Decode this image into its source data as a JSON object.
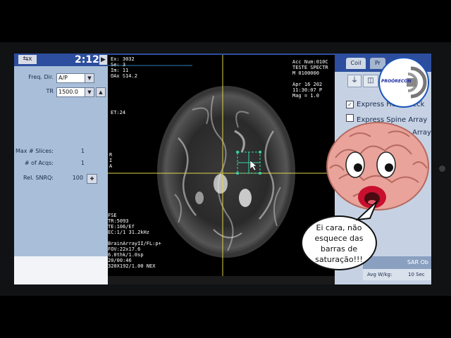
{
  "left_panel": {
    "tab_label": "⇆x",
    "clock": "2:12",
    "arrow": "▶",
    "fields": [
      {
        "label": "Freq. Dir.",
        "value": "A/P"
      },
      {
        "label": "TR",
        "value": "1500.0"
      }
    ],
    "stats": [
      {
        "label": "Max # Slices:",
        "value": "1"
      },
      {
        "label": "# of Acqs:",
        "value": "1"
      },
      {
        "label": "Rel. SNRQ:",
        "value": "100"
      }
    ]
  },
  "viewer": {
    "top_left": "Ex: 3032\nSe: 3\nIm: 11\nOAx S14.2",
    "top_right": "Acc Num:010C\nTESTE SPECTR\nM 0100000\n\nApr 16 202\n11:30:07 P\nMag = 1.0",
    "left_mid": "ET:24",
    "left_side": "R\nI\nA",
    "bottom_left": "FSE\nTR:5093\nTE:106/Ef\nEC:1/1 31.2kHz\n\nBrainArrayII/FL:p+\nFOV:22x17.6\n6.0thk/1.0sp\n20/00:46\n320X192/1.00 NEX"
  },
  "right_panel": {
    "tabs": [
      "Coil",
      "Pr"
    ],
    "items": [
      {
        "label": "Express Head Neck",
        "checked": true
      },
      {
        "label": "Express Spine Array",
        "checked": false
      },
      {
        "label": "Array",
        "checked": false
      }
    ],
    "sar_label": "SAR Ob",
    "avg_label": "Avg W/kg:",
    "avg_value": "10 Sec"
  },
  "logo": {
    "text": "PROÓRECON"
  },
  "bubble": {
    "lines": [
      "Ei cara, não",
      "esquece das",
      "barras de",
      "saturação!!!"
    ]
  },
  "colors": {
    "panel_blue": "#a9bfd9",
    "header_blue": "#2d4e9e",
    "crosshair": "#e0d24a",
    "roi": "#35d6a8"
  }
}
